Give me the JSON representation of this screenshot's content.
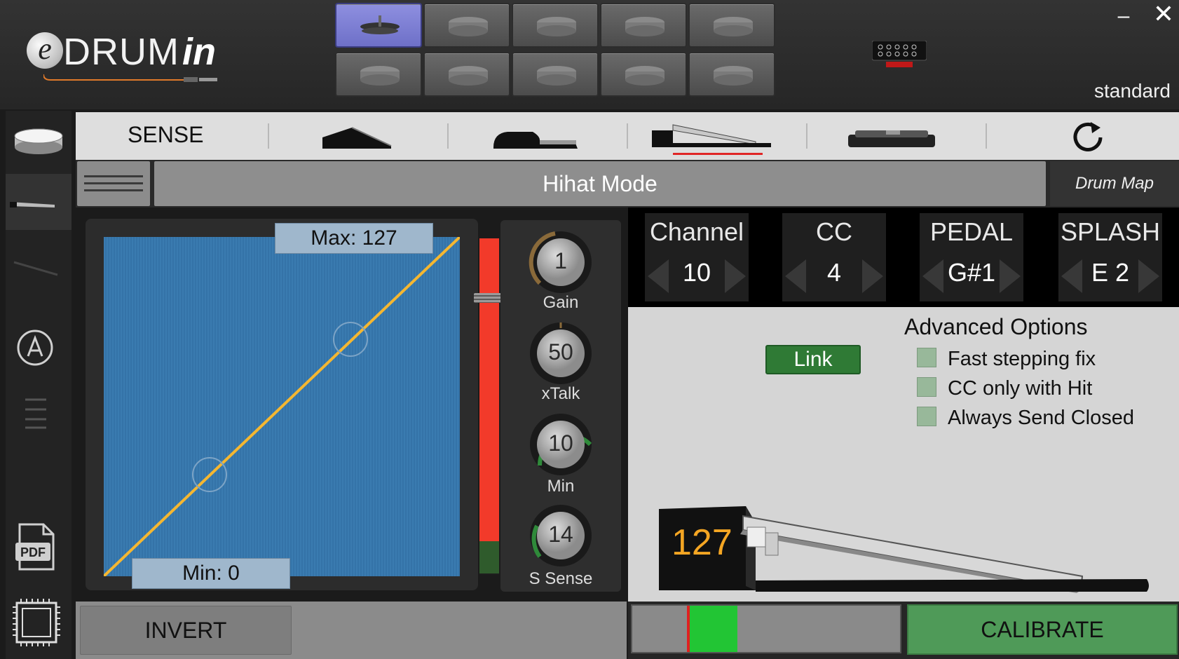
{
  "app": {
    "logo_e": "e",
    "logo_drum": "DRUM",
    "logo_in": "in",
    "profile": "standard",
    "window_min": "–",
    "window_close": "✕"
  },
  "pad_selector": {
    "selected_index": 0,
    "buttons": [
      {
        "icon": "hihat-icon"
      },
      {
        "icon": "drum-pad-icon"
      },
      {
        "icon": "drum-pad-icon"
      },
      {
        "icon": "drum-pad-icon"
      },
      {
        "icon": "drum-pad-icon"
      },
      {
        "icon": "drum-pad-icon"
      },
      {
        "icon": "drum-pad-icon"
      },
      {
        "icon": "drum-pad-icon"
      },
      {
        "icon": "drum-pad-icon"
      },
      {
        "icon": "drum-pad-icon"
      }
    ]
  },
  "sidebar": {
    "items": [
      {
        "icon": "snare-drum-icon"
      },
      {
        "icon": "hihat-pedal-icon",
        "active": true
      },
      {
        "icon": "pedal-line-icon"
      },
      {
        "icon": "a-circle-icon"
      },
      {
        "icon": "menu-lines-icon"
      },
      {
        "icon": "pdf-icon",
        "text": "PDF"
      },
      {
        "icon": "chip-icon"
      }
    ]
  },
  "toolbar": {
    "sense_label": "SENSE",
    "pedal_types": [
      "pedal-type-1-icon",
      "pedal-type-2-icon",
      "pedal-type-3-icon",
      "pedal-type-4-icon"
    ],
    "selected_pedal": 2,
    "refresh_icon": "refresh-icon"
  },
  "mode_bar": {
    "title": "Hihat Mode",
    "drum_map_label": "Drum Map"
  },
  "curve": {
    "max_label": "Max: 127",
    "min_label": "Min: 0",
    "line_color": "#f5b731",
    "background": "#3a7bb0"
  },
  "meter": {
    "level": 0.9
  },
  "knobs": [
    {
      "value": "1",
      "label": "Gain"
    },
    {
      "value": "50",
      "label": "xTalk"
    },
    {
      "value": "10",
      "label": "Min"
    },
    {
      "value": "14",
      "label": "S Sense"
    }
  ],
  "midi": [
    {
      "title": "Channel",
      "value": "10"
    },
    {
      "title": "CC",
      "value": "4"
    },
    {
      "title": "PEDAL",
      "value": "G#1"
    },
    {
      "title": "SPLASH",
      "value": "E 2"
    }
  ],
  "advanced": {
    "link_label": "Link",
    "title": "Advanced Options",
    "options": [
      {
        "label": "Fast stepping fix"
      },
      {
        "label": "CC only with Hit"
      },
      {
        "label": "Always Send Closed"
      }
    ]
  },
  "pedal_value": "127",
  "bottom": {
    "invert_label": "INVERT",
    "calibrate_label": "CALIBRATE"
  }
}
